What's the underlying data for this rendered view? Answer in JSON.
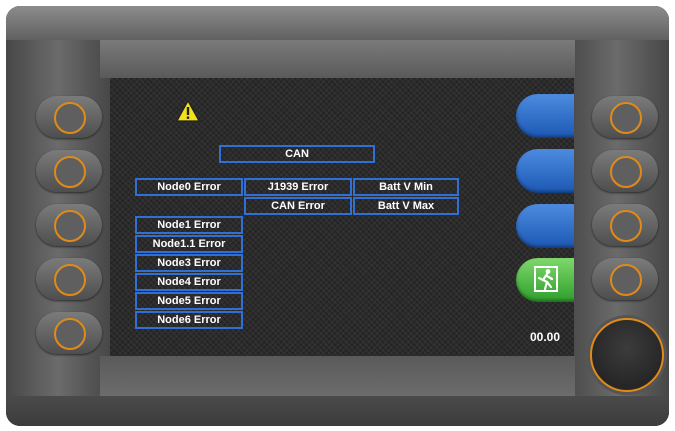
{
  "screen": {
    "header": "CAN",
    "row1": [
      "Node0 Error",
      "J1939 Error",
      "Batt V Min"
    ],
    "row2": [
      "CAN Error",
      "Batt V Max"
    ],
    "node_list": [
      "Node1 Error",
      "Node1.1 Error",
      "Node3 Error",
      "Node4 Error",
      "Node5 Error",
      "Node6 Error"
    ],
    "time": "00.00"
  },
  "softkeys": [
    "blue",
    "blue",
    "blue",
    "exit"
  ],
  "colors": {
    "box_border": "#2f6fd6",
    "softkey_blue": "#1c58b4",
    "softkey_exit": "#2e9e2c",
    "button_ring": "#e08a1a",
    "screen_bg": "#2b2b2b"
  },
  "icons": [
    "warning-icon",
    "exit-icon"
  ]
}
